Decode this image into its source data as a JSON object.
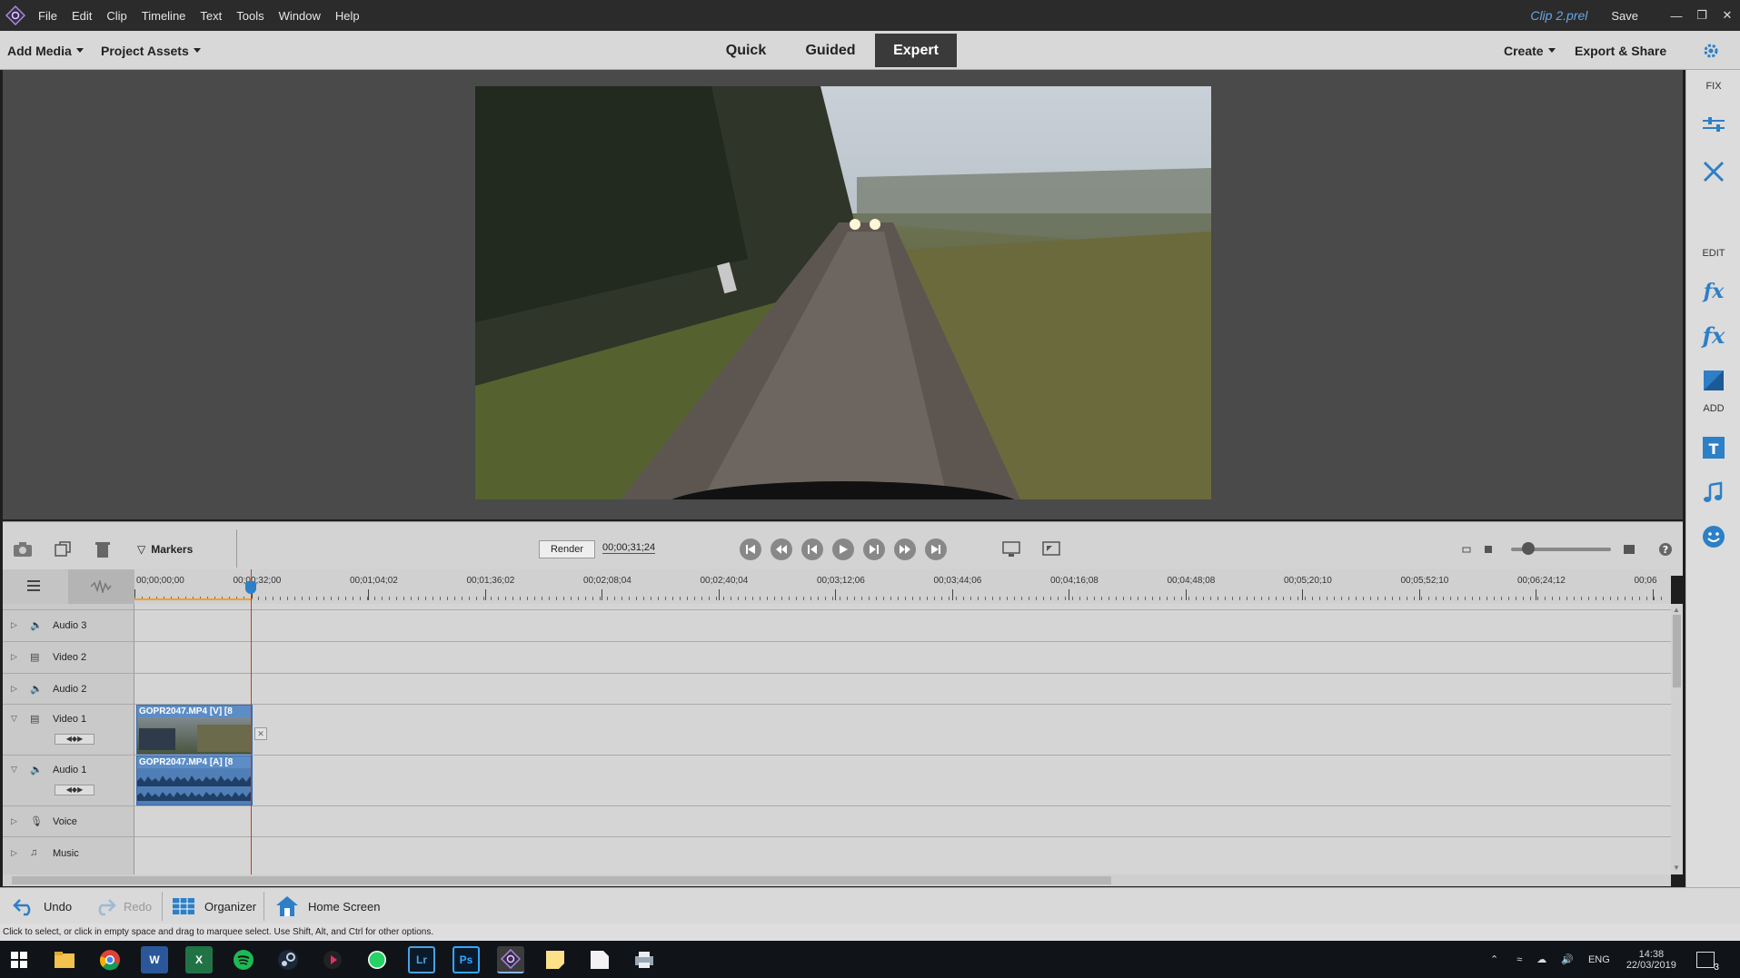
{
  "menubar": {
    "items": [
      "File",
      "Edit",
      "Clip",
      "Timeline",
      "Text",
      "Tools",
      "Window",
      "Help"
    ],
    "project_name": "Clip 2.prel",
    "save_label": "Save"
  },
  "modebar": {
    "add_media": "Add Media",
    "project_assets": "Project Assets",
    "tabs": [
      "Quick",
      "Guided",
      "Expert"
    ],
    "active_tab": "Expert",
    "create": "Create",
    "export_share": "Export & Share"
  },
  "right_panel": {
    "fix_label": "FIX",
    "edit_label": "EDIT",
    "add_label": "ADD"
  },
  "timeline_toolbar": {
    "markers_label": "Markers",
    "render_label": "Render",
    "timecode": "00;00;31;24"
  },
  "ruler": {
    "ticks": [
      "00;00;00;00",
      "00;00;32;00",
      "00;01;04;02",
      "00;01;36;02",
      "00;02;08;04",
      "00;02;40;04",
      "00;03;12;06",
      "00;03;44;06",
      "00;04;16;08",
      "00;04;48;08",
      "00;05;20;10",
      "00;05;52;10",
      "00;06;24;12",
      "00;06"
    ]
  },
  "tracks": [
    {
      "name": "Audio 3"
    },
    {
      "name": "Video 2"
    },
    {
      "name": "Audio 2"
    },
    {
      "name": "Video 1"
    },
    {
      "name": "Audio 1"
    },
    {
      "name": "Voice"
    },
    {
      "name": "Music"
    }
  ],
  "clips": {
    "video": "GOPR2047.MP4 [V] [8",
    "audio": "GOPR2047.MP4 [A] [8"
  },
  "bottombar": {
    "undo": "Undo",
    "redo": "Redo",
    "organizer": "Organizer",
    "home_screen": "Home Screen"
  },
  "status_text": "Click to select, or click in empty space and drag to marquee select. Use Shift, Alt, and Ctrl for other options.",
  "taskbar": {
    "lang": "ENG",
    "time": "14:38",
    "date": "22/03/2019",
    "notifications": "3"
  }
}
